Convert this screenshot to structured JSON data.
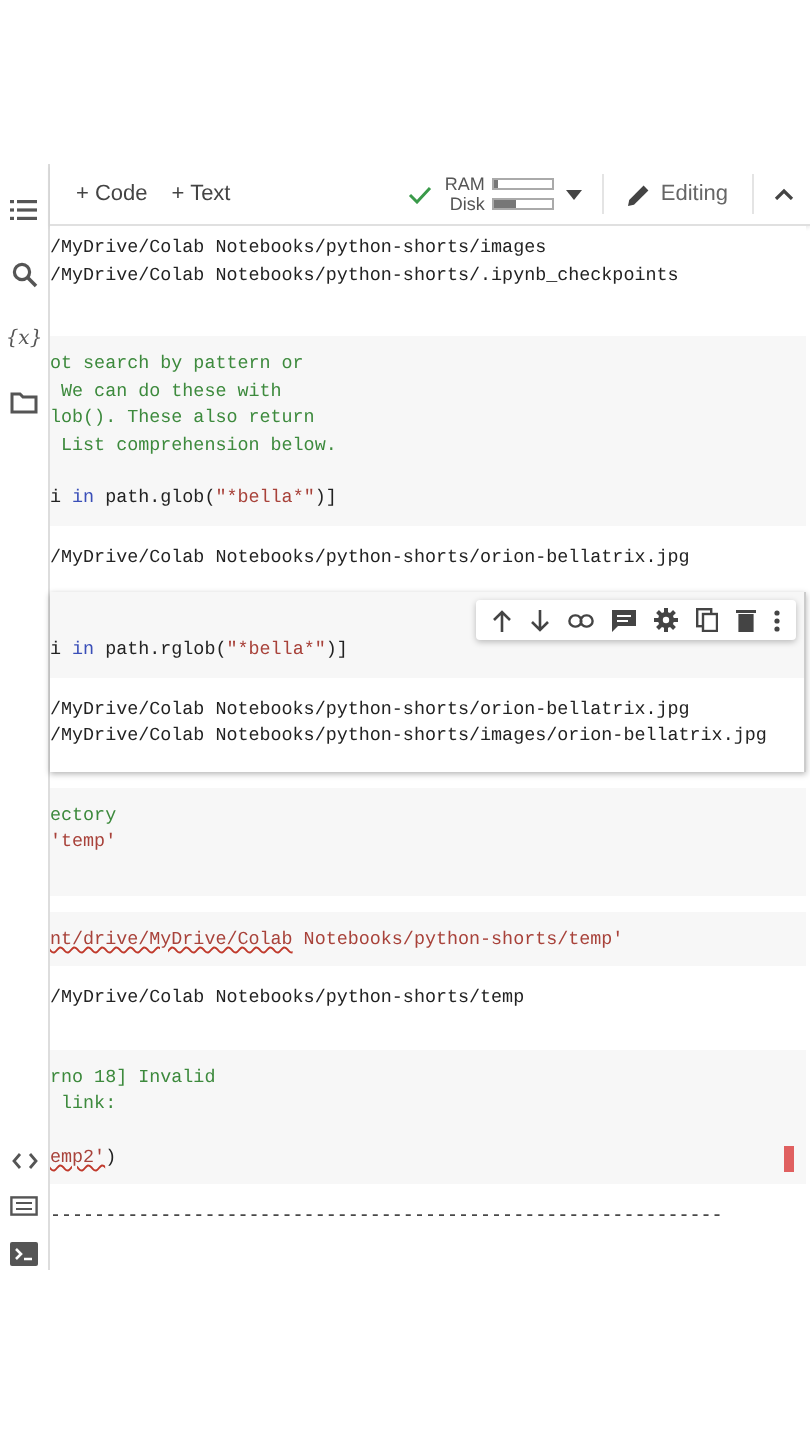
{
  "toolbar": {
    "add_code": "+ Code",
    "add_text": "+ Text",
    "ram_label": "RAM",
    "ram": {
      "level": 0.05
    },
    "disk_label": "Disk",
    "disk": {
      "level": 0.35
    },
    "mode": "Editing"
  },
  "sidebar_top": [
    "{x}"
  ],
  "cells": [
    {
      "focused": false,
      "error_mark": false,
      "output": [
        "/MyDrive/Colab Notebooks/python-shorts/images",
        "/MyDrive/Colab Notebooks/python-shorts/.ipynb_checkpoints"
      ]
    },
    {
      "focused": false,
      "error_mark": false,
      "code": [
        [
          [
            {
              "text": "ot search by pattern or",
              "kind": "comment"
            }
          ],
          [
            {
              "text": " We can do these with",
              "kind": "comment"
            }
          ],
          [
            {
              "text": "lob(). These also return",
              "kind": "comment"
            }
          ],
          [
            {
              "text": " List comprehension below.",
              "kind": "comment"
            }
          ]
        ],
        [
          [
            {
              "text": "i ",
              "kind": "plain"
            },
            {
              "text": "in",
              "kind": "keyword"
            },
            {
              "text": " path.glob(",
              "kind": "plain"
            },
            {
              "text": "\"*bella*\"",
              "kind": "string"
            },
            {
              "text": ")]",
              "kind": "plain"
            }
          ]
        ]
      ],
      "output": [
        "/MyDrive/Colab Notebooks/python-shorts/orion-bellatrix.jpg"
      ]
    },
    {
      "focused": true,
      "error_mark": false,
      "code": [
        [
          [
            {
              "text": "i ",
              "kind": "plain"
            },
            {
              "text": "in",
              "kind": "keyword"
            },
            {
              "text": " path.rglob(",
              "kind": "plain"
            },
            {
              "text": "\"*bella*\"",
              "kind": "string"
            },
            {
              "text": ")]",
              "kind": "plain"
            }
          ]
        ]
      ],
      "output": [
        "/MyDrive/Colab Notebooks/python-shorts/orion-bellatrix.jpg",
        "/MyDrive/Colab Notebooks/python-shorts/images/orion-bellatrix.jpg"
      ]
    },
    {
      "focused": false,
      "error_mark": false,
      "code": [
        [
          [
            {
              "text": "ectory",
              "kind": "comment"
            }
          ],
          [
            {
              "text": "'temp'",
              "kind": "string"
            }
          ]
        ]
      ]
    },
    {
      "focused": false,
      "error_mark": false,
      "code": [
        [
          [
            {
              "text": "nt/drive/MyDrive/Colab",
              "kind": "string",
              "squiggle": true
            },
            {
              "text": " Notebooks/python-shorts/temp'",
              "kind": "string"
            }
          ]
        ]
      ],
      "output": [
        "/MyDrive/Colab Notebooks/python-shorts/temp"
      ]
    },
    {
      "focused": false,
      "error_mark": true,
      "code": [
        [
          [
            {
              "text": "rno 18] Invalid",
              "kind": "comment"
            }
          ],
          [
            {
              "text": " link:",
              "kind": "comment"
            }
          ]
        ],
        [
          [
            {
              "text": "emp2'",
              "kind": "string",
              "squiggle": true
            },
            {
              "text": ")",
              "kind": "plain"
            }
          ]
        ]
      ],
      "output": [
        "-------------------------------------------------------------"
      ]
    }
  ]
}
